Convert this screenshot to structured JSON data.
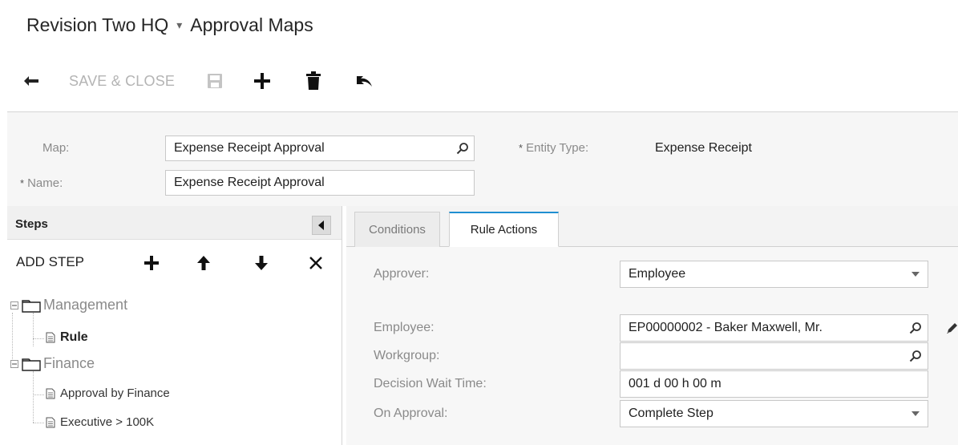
{
  "header": {
    "company": "Revision Two HQ",
    "separator": "▾",
    "screen": "Approval Maps"
  },
  "toolbar": {
    "save_close_label": "SAVE & CLOSE"
  },
  "form": {
    "map_label": "Map:",
    "map_value": "Expense Receipt Approval",
    "name_label": "Name:",
    "name_value": "Expense Receipt Approval",
    "entity_type_label": "Entity Type:",
    "entity_type_value": "Expense Receipt",
    "required_mark": "*"
  },
  "steps": {
    "title": "Steps",
    "add_step_label": "ADD STEP",
    "tree": [
      {
        "label": "Management",
        "type": "group"
      },
      {
        "label": "Rule",
        "type": "leaf",
        "selected": true
      },
      {
        "label": "Finance",
        "type": "group"
      },
      {
        "label": "Approval by Finance",
        "type": "leaf"
      },
      {
        "label": "Executive > 100K",
        "type": "leaf"
      }
    ]
  },
  "tabs": [
    {
      "label": "Conditions",
      "active": false
    },
    {
      "label": "Rule Actions",
      "active": true
    }
  ],
  "rule_actions": {
    "approver_label": "Approver:",
    "approver_value": "Employee",
    "employee_label": "Employee:",
    "employee_value": "EP00000002 - Baker Maxwell, Mr.",
    "workgroup_label": "Workgroup:",
    "workgroup_value": "",
    "decision_wait_label": "Decision Wait Time:",
    "decision_wait_value": "001 d 00 h 00 m",
    "on_approval_label": "On Approval:",
    "on_approval_value": "Complete Step"
  },
  "colors": {
    "accent": "#1f8fd1",
    "disabled_text": "#b4b4b4",
    "label_text": "#8a8a8a"
  },
  "icons": [
    "back-arrow-icon",
    "save-icon",
    "plus-icon",
    "trash-icon",
    "undo-icon",
    "search-icon",
    "folder-icon",
    "document-icon",
    "arrow-up-icon",
    "arrow-down-icon",
    "close-icon",
    "triangle-left-icon",
    "chevron-down-icon",
    "pencil-icon"
  ]
}
